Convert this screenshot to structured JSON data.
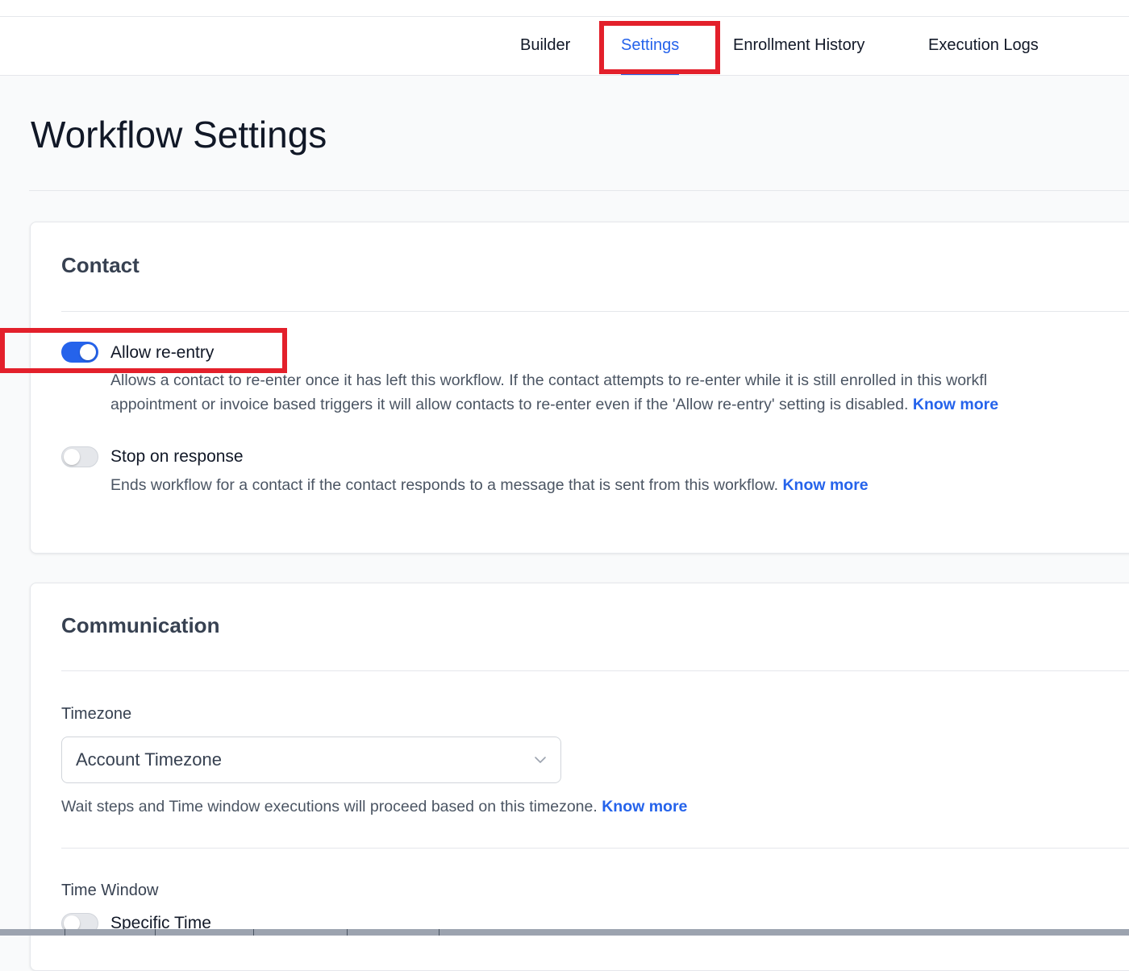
{
  "nav": {
    "tabs": [
      {
        "label": "Builder"
      },
      {
        "label": "Settings"
      },
      {
        "label": "Enrollment History"
      },
      {
        "label": "Execution Logs"
      }
    ],
    "active_tab": "Settings"
  },
  "page": {
    "title": "Workflow Settings"
  },
  "contact": {
    "title": "Contact",
    "allow_reentry": {
      "label": "Allow re-entry",
      "enabled": true,
      "desc_line1": "Allows a contact to re-enter once it has left this workflow. If the contact attempts to re-enter while it is still enrolled in this workfl",
      "desc_line2": "appointment or invoice based triggers it will allow contacts to re-enter even if the 'Allow re-entry' setting is disabled.",
      "link": "Know more"
    },
    "stop_on_response": {
      "label": "Stop on response",
      "enabled": false,
      "desc": "Ends workflow for a contact if the contact responds to a message that is sent from this workflow.",
      "link": "Know more"
    }
  },
  "communication": {
    "title": "Communication",
    "timezone": {
      "label": "Timezone",
      "value": "Account Timezone",
      "help": "Wait steps and Time window executions will proceed based on this timezone.",
      "link": "Know more"
    },
    "time_window": {
      "label": "Time Window",
      "specific_time": {
        "label": "Specific Time",
        "enabled": false
      }
    }
  },
  "colors": {
    "accent": "#2563eb",
    "highlight": "#e3202b",
    "toggle_off": "#e5e7eb"
  },
  "icons": {
    "select_chevron": "chevron-down-icon"
  }
}
